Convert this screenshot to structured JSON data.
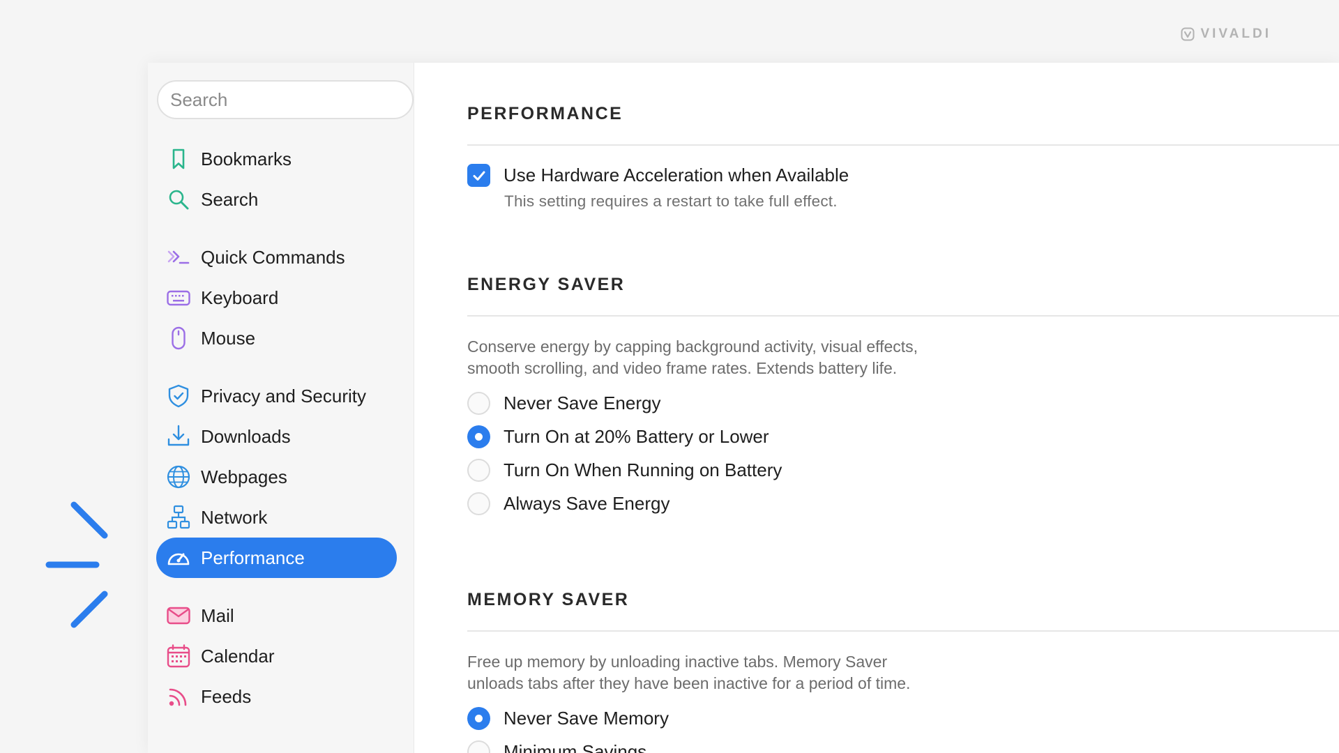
{
  "brand": {
    "name": "VIVALDI",
    "icon": "vivaldi-logo-icon"
  },
  "colors": {
    "accent": "#2b7ded",
    "sidebar_bg": "#f6f6f6",
    "page_bg": "#f5f5f5"
  },
  "sidebar": {
    "search_placeholder": "Search",
    "groups": [
      [
        {
          "label": "Bookmarks",
          "icon": "bookmark-icon"
        },
        {
          "label": "Search",
          "icon": "search-icon"
        }
      ],
      [
        {
          "label": "Quick Commands",
          "icon": "quick-commands-icon"
        },
        {
          "label": "Keyboard",
          "icon": "keyboard-icon"
        },
        {
          "label": "Mouse",
          "icon": "mouse-icon"
        }
      ],
      [
        {
          "label": "Privacy and Security",
          "icon": "shield-icon"
        },
        {
          "label": "Downloads",
          "icon": "download-icon"
        },
        {
          "label": "Webpages",
          "icon": "globe-icon"
        },
        {
          "label": "Network",
          "icon": "network-icon"
        },
        {
          "label": "Performance",
          "icon": "speedometer-icon",
          "active": true
        }
      ],
      [
        {
          "label": "Mail",
          "icon": "mail-icon"
        },
        {
          "label": "Calendar",
          "icon": "calendar-icon"
        },
        {
          "label": "Feeds",
          "icon": "feed-icon"
        }
      ]
    ]
  },
  "performance": {
    "title": "PERFORMANCE",
    "hardware_acceleration": {
      "label": "Use Hardware Acceleration when Available",
      "checked": true,
      "helper": "This setting requires a restart to take full effect."
    }
  },
  "energy_saver": {
    "title": "ENERGY SAVER",
    "description_line1": "Conserve energy by capping background activity, visual effects,",
    "description_line2": "smooth scrolling, and video frame rates. Extends battery life.",
    "options": [
      {
        "label": "Never Save Energy",
        "selected": false
      },
      {
        "label": "Turn On at 20% Battery or Lower",
        "selected": true
      },
      {
        "label": "Turn On When Running on Battery",
        "selected": false
      },
      {
        "label": "Always Save Energy",
        "selected": false
      }
    ]
  },
  "memory_saver": {
    "title": "MEMORY SAVER",
    "description_line1": "Free up memory by unloading inactive tabs. Memory Saver",
    "description_line2": "unloads tabs after they have been inactive for a period of time.",
    "options": [
      {
        "label": "Never Save Memory",
        "selected": true
      },
      {
        "label": "Minimum Savings",
        "selected": false
      }
    ]
  }
}
